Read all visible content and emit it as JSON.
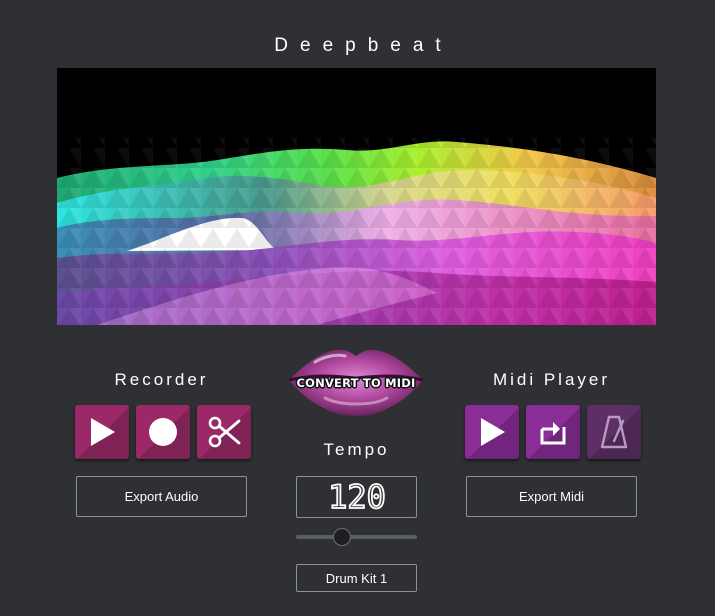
{
  "app": {
    "title": "Deepbeat"
  },
  "visualizer": {
    "description_icon": "waveform-terrain"
  },
  "recorder": {
    "title": "Recorder",
    "buttons": [
      {
        "icon": "play-icon"
      },
      {
        "icon": "record-icon"
      },
      {
        "icon": "scissors-icon"
      }
    ],
    "export_label": "Export Audio"
  },
  "convert": {
    "label": "CONVERT TO MIDI",
    "icon": "lips-icon"
  },
  "tempo": {
    "title": "Tempo",
    "value": "120",
    "slider_fraction": 0.38
  },
  "drum_kit": {
    "label": "Drum Kit 1"
  },
  "midi_player": {
    "title": "Midi Player",
    "buttons": [
      {
        "icon": "play-icon"
      },
      {
        "icon": "loop-icon"
      },
      {
        "icon": "metronome-icon"
      }
    ],
    "export_label": "Export Midi"
  },
  "colors": {
    "background": "#2e3033",
    "recorder_accent": "#9b2968",
    "midi_accent": "#8a2d97",
    "midi_disabled": "#5d2f66"
  }
}
